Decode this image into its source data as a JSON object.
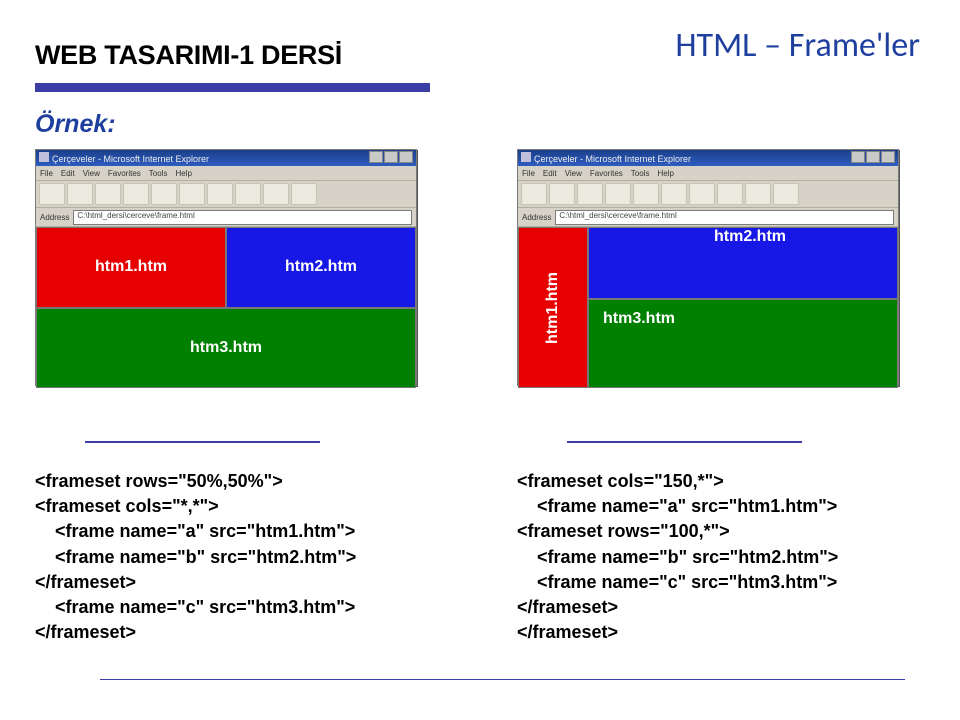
{
  "hdr_left": "WEB TASARIMI-1 DERSİ",
  "hdr_right": "HTML – Frame'ler",
  "example_label": "Örnek:",
  "win": {
    "title": "Çerçeveler - Microsoft Internet Explorer",
    "menu": [
      "File",
      "Edit",
      "View",
      "Favorites",
      "Tools",
      "Help"
    ],
    "addr_label": "Address",
    "addr_value": "C:\\html_dersi\\cerceve\\frame.html"
  },
  "ex1": {
    "f1": "htm1.htm",
    "f2": "htm2.htm",
    "f3": "htm3.htm",
    "code": "<frameset rows=\"50%,50%\">\n<frameset cols=\"*,*\">\n    <frame name=\"a\" src=\"htm1.htm\">\n    <frame name=\"b\" src=\"htm2.htm\">\n</frameset>\n    <frame name=\"c\" src=\"htm3.htm\">\n</frameset>"
  },
  "ex2": {
    "f1": "htm1.htm",
    "f2": "htm2.htm",
    "f3": "htm3.htm",
    "code": "<frameset cols=\"150,*\">\n    <frame name=\"a\" src=\"htm1.htm\">\n<frameset rows=\"100,*\">\n    <frame name=\"b\" src=\"htm2.htm\">\n    <frame name=\"c\" src=\"htm3.htm\">\n</frameset>\n</frameset>"
  }
}
